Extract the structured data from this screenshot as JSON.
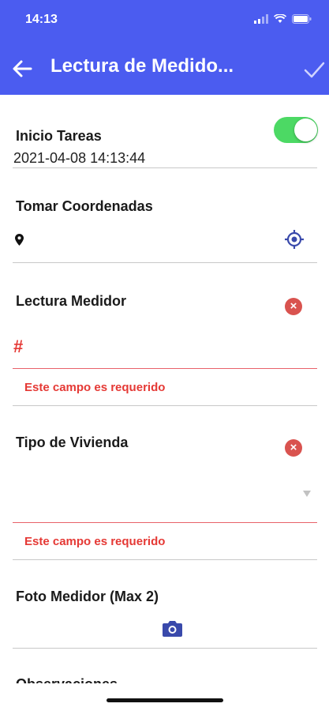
{
  "status_bar": {
    "time": "14:13"
  },
  "header": {
    "title": "Lectura de Medido..."
  },
  "form": {
    "inicio_tareas": {
      "label": "Inicio Tareas",
      "value": "2021-04-08 14:13:44",
      "toggle_on": true
    },
    "coordenadas": {
      "label": "Tomar Coordenadas"
    },
    "lectura": {
      "label": "Lectura Medidor",
      "placeholder": "#",
      "error": "Este campo es requerido"
    },
    "vivienda": {
      "label": "Tipo de Vivienda",
      "error": "Este campo es requerido"
    },
    "foto": {
      "label": "Foto Medidor (Max 2)"
    },
    "observaciones": {
      "label": "Observaciones"
    }
  },
  "colors": {
    "header": "#4b5cf0",
    "toggle_on": "#4cd964",
    "error": "#e53935",
    "icon_blue": "#3949ab"
  },
  "icons": [
    "back-arrow-icon",
    "check-icon",
    "map-pin-icon",
    "gps-target-icon",
    "clear-icon",
    "dropdown-arrow-icon",
    "camera-icon"
  ]
}
